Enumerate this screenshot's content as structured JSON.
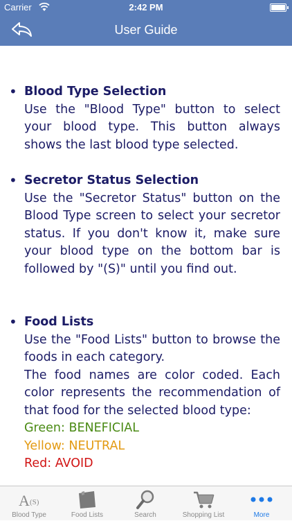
{
  "status_bar": {
    "carrier": "Carrier",
    "time": "2:42 PM"
  },
  "nav": {
    "title": "User Guide",
    "back_icon": "back-arrow-icon"
  },
  "sections": [
    {
      "heading": "Blood Type Selection",
      "lines": [
        "Use the \"Blood Type\" button to select your blood type. This button always shows the last blood type selected."
      ]
    },
    {
      "heading": "Secretor Status Selection",
      "lines": [
        "Use the \"Secretor Status\" button on the Blood Type screen to select your secretor status. If you don't know it, make sure your blood type on the bottom bar is followed by \"(S)\" until you find out."
      ]
    },
    {
      "heading": "Food Lists",
      "lines": [
        "Use the \"Food Lists\" button to browse the foods in each category.",
        "The food names are color coded. Each color represents the recommendation of that food for the selected blood type:"
      ],
      "colors": [
        {
          "text": "Green: BENEFICIAL",
          "color": "#4a8a14"
        },
        {
          "text": "Yellow: NEUTRAL",
          "color": "#e39a12"
        },
        {
          "text": "Red: AVOID",
          "color": "#d11515"
        }
      ]
    }
  ],
  "tabs": [
    {
      "label": "Blood Type",
      "icon": "blood-type-icon",
      "active": false
    },
    {
      "label": "Food Lists",
      "icon": "food-lists-icon",
      "active": false
    },
    {
      "label": "Search",
      "icon": "search-icon",
      "active": false
    },
    {
      "label": "Shopping List",
      "icon": "shopping-cart-icon",
      "active": false
    },
    {
      "label": "More",
      "icon": "more-icon",
      "active": true
    }
  ],
  "theme": {
    "nav_color": "#5a7db8",
    "text_color": "#1c1c66",
    "active_tab_color": "#1e7ae6"
  }
}
